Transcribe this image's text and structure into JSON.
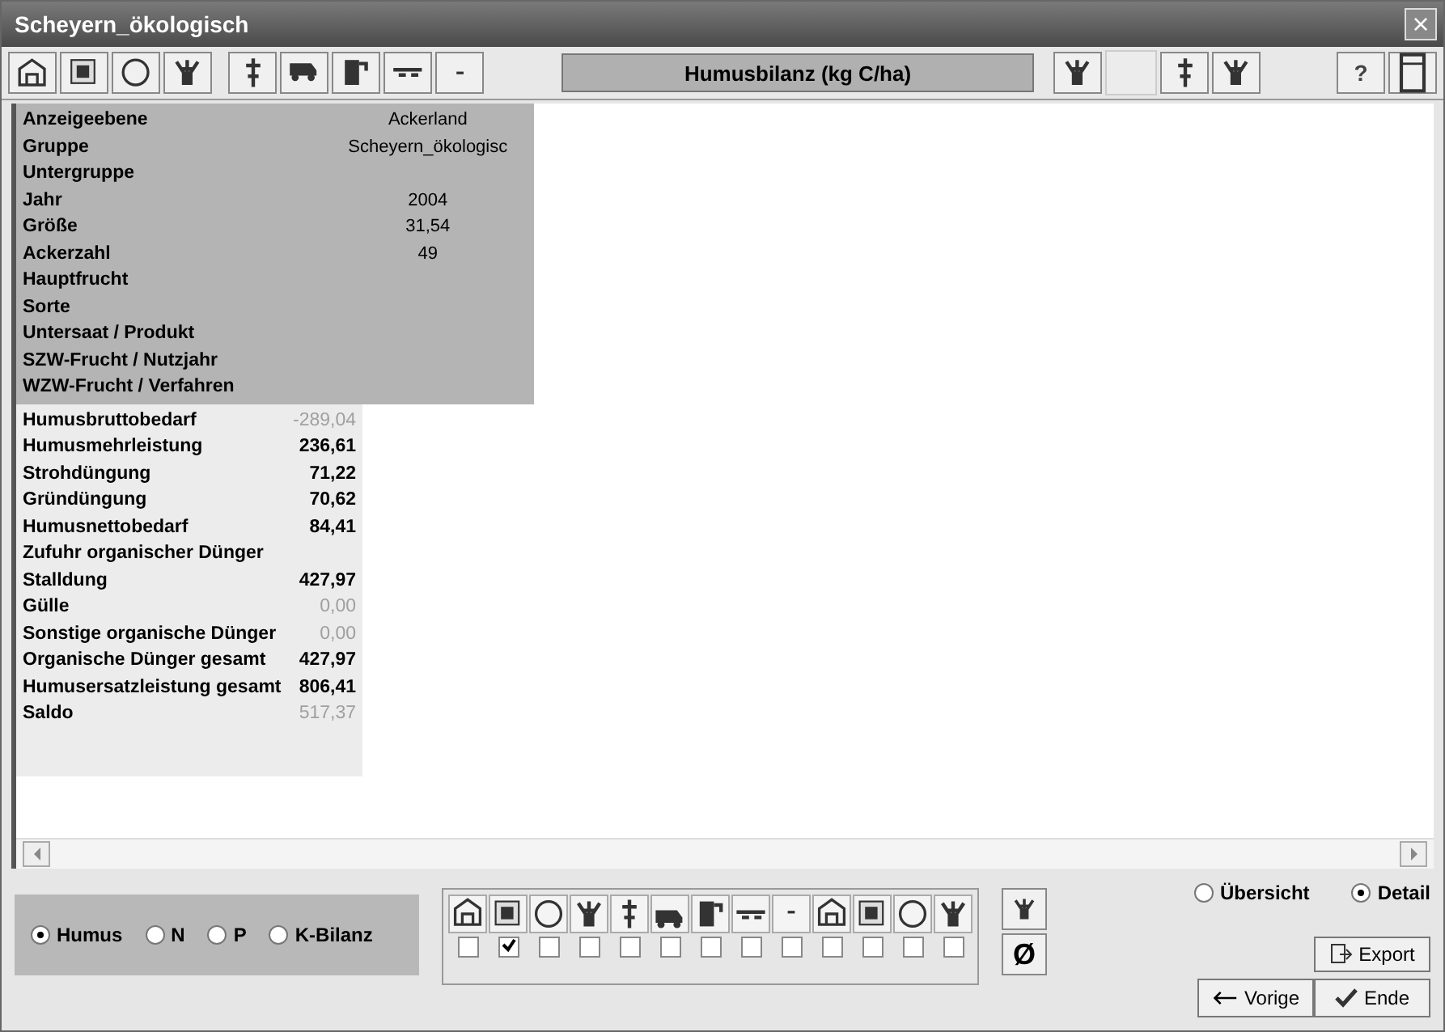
{
  "window": {
    "title": "Scheyern_ökologisch",
    "close": "×"
  },
  "toolbar": {
    "caption": "Humusbilanz  (kg C/ha)",
    "help": "?"
  },
  "header_rows": [
    {
      "label": "Anzeigeebene",
      "value": "Ackerland"
    },
    {
      "label": "Gruppe",
      "value": "Scheyern_ökologisc"
    },
    {
      "label": "Untergruppe"
    },
    {
      "label": "Jahr",
      "value": "2004"
    },
    {
      "label": "Größe",
      "value": "31,54"
    },
    {
      "label": "Ackerzahl",
      "value": "49"
    },
    {
      "label": "Hauptfrucht"
    },
    {
      "label": "Sorte"
    },
    {
      "label": "Untersaat / Produkt"
    },
    {
      "label": "SZW-Frucht / Nutzjahr"
    },
    {
      "label": "WZW-Frucht / Verfahren"
    }
  ],
  "data_rows": [
    {
      "label": "Humusbruttobedarf",
      "value": "-289,04",
      "dimmed": true
    },
    {
      "label": "Humusmehrleistung",
      "value": "236,61",
      "dimmed": false
    },
    {
      "label": "Strohdüngung",
      "value": "71,22",
      "dimmed": false
    },
    {
      "label": "Gründüngung",
      "value": "70,62",
      "dimmed": false
    },
    {
      "label": "Humusnettobedarf",
      "value": "84,41",
      "dimmed": false
    },
    {
      "label": "Zufuhr organischer Dünger"
    },
    {
      "label": "Stalldung",
      "value": "427,97",
      "dimmed": false
    },
    {
      "label": "Gülle",
      "value": "0,00",
      "dimmed": true
    },
    {
      "label": "Sonstige organische Dünger",
      "value": "0,00",
      "dimmed": true
    },
    {
      "label": "Organische Dünger gesamt",
      "value": "427,97",
      "dimmed": false
    },
    {
      "label": "Humusersatzleistung gesamt",
      "value": "806,41",
      "dimmed": false
    },
    {
      "label": "Saldo",
      "value": "517,37",
      "dimmed": true
    }
  ],
  "balance_radios": [
    {
      "label": "Humus",
      "selected": true
    },
    {
      "label": "N",
      "selected": false
    },
    {
      "label": "P",
      "selected": false
    },
    {
      "label": "K-Bilanz",
      "selected": false
    }
  ],
  "filters": [
    {
      "checked": false
    },
    {
      "checked": true
    },
    {
      "checked": false
    },
    {
      "checked": false
    },
    {
      "checked": false
    },
    {
      "checked": false
    },
    {
      "checked": false
    },
    {
      "checked": false
    },
    {
      "checked": false
    },
    {
      "checked": false
    },
    {
      "checked": false
    },
    {
      "checked": false
    },
    {
      "checked": false
    }
  ],
  "clear_button": "Ø",
  "view_radios": [
    {
      "label": "Übersicht",
      "selected": false
    },
    {
      "label": "Detail",
      "selected": true
    }
  ],
  "buttons": {
    "export": "Export",
    "back": "Vorige",
    "end": "Ende"
  }
}
